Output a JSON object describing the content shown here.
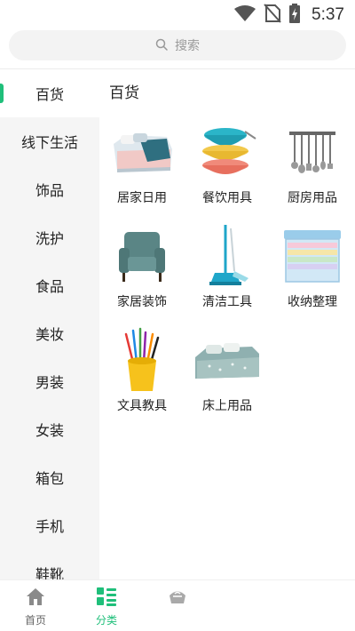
{
  "status_bar": {
    "time": "5:37"
  },
  "search": {
    "placeholder": "搜索"
  },
  "colors": {
    "accent": "#1fbf7a",
    "sidebar_bg": "#f5f5f5",
    "search_bg": "#f3f3f3"
  },
  "sidebar": {
    "items": [
      {
        "label": "百货",
        "active": true
      },
      {
        "label": "线下生活",
        "active": false
      },
      {
        "label": "饰品",
        "active": false
      },
      {
        "label": "洗护",
        "active": false
      },
      {
        "label": "食品",
        "active": false
      },
      {
        "label": "美妆",
        "active": false
      },
      {
        "label": "男装",
        "active": false
      },
      {
        "label": "女装",
        "active": false
      },
      {
        "label": "箱包",
        "active": false
      },
      {
        "label": "手机",
        "active": false
      },
      {
        "label": "鞋靴",
        "active": false
      }
    ]
  },
  "content": {
    "title": "百货",
    "items": [
      {
        "label": "居家日用",
        "icon": "bedding-image"
      },
      {
        "label": "餐饮用具",
        "icon": "bowls-image"
      },
      {
        "label": "厨房用品",
        "icon": "kitchen-utensils-image"
      },
      {
        "label": "家居装饰",
        "icon": "armchair-image"
      },
      {
        "label": "清洁工具",
        "icon": "mop-image"
      },
      {
        "label": "收纳整理",
        "icon": "storage-boxes-image"
      },
      {
        "label": "文具教具",
        "icon": "pencil-cup-image"
      },
      {
        "label": "床上用品",
        "icon": "bed-image"
      }
    ]
  },
  "tabbar": {
    "tabs": [
      {
        "label": "首页",
        "icon": "home-icon",
        "active": false
      },
      {
        "label": "分类",
        "icon": "category-icon",
        "active": true
      },
      {
        "label": "",
        "icon": "cart-icon",
        "active": false
      }
    ]
  }
}
